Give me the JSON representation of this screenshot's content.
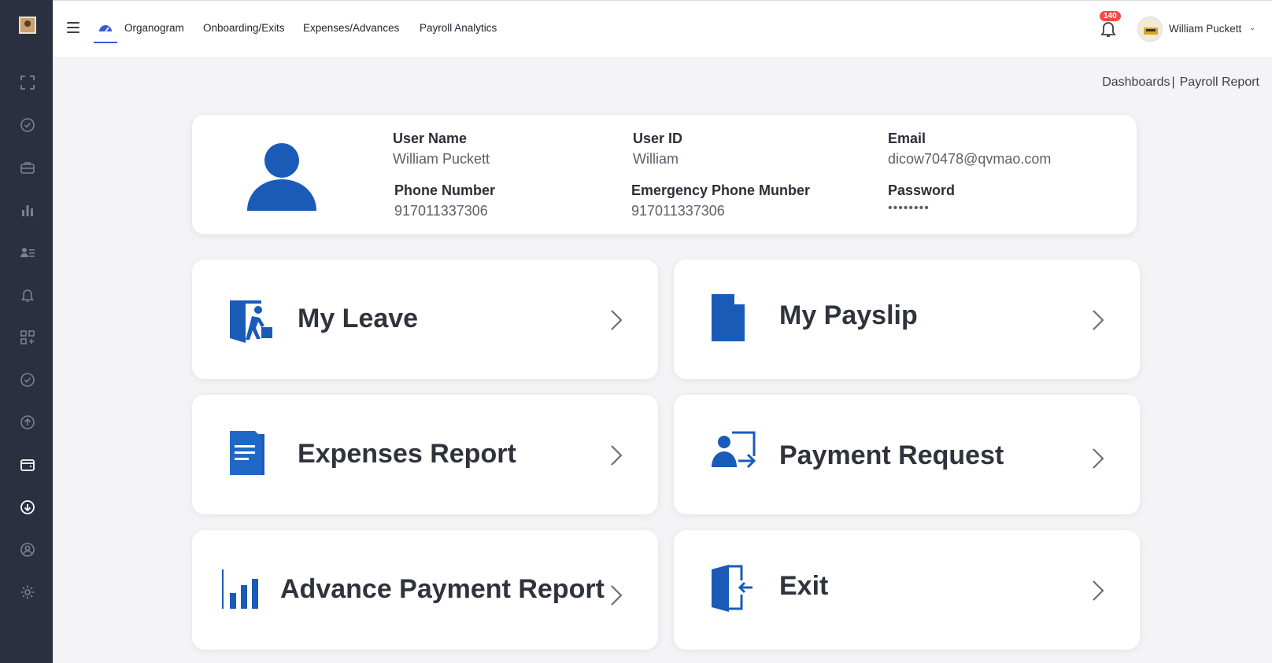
{
  "topbar": {
    "nav": [
      "Organogram",
      "Onboarding/Exits",
      "Expenses/Advances",
      "Payroll Analytics"
    ],
    "notifications_count": "140",
    "user_name": "William Puckett"
  },
  "breadcrumb": {
    "parent": "Dashboards",
    "separator": "|",
    "current": "Payroll Report"
  },
  "profile": {
    "user_name_label": "User Name",
    "user_name": "William Puckett",
    "user_id_label": "User ID",
    "user_id": "William",
    "email_label": "Email",
    "email": "dicow70478@qvmao.com",
    "phone_label": "Phone Number",
    "phone": "917011337306",
    "emergency_label": "Emergency Phone Munber",
    "emergency_phone": "917011337306",
    "password_label": "Password",
    "password": "••••••••"
  },
  "tiles": {
    "my_leave": "My Leave",
    "my_payslip": "My Payslip",
    "expenses_report": "Expenses Report",
    "payment_request": "Payment Request",
    "advance_payment_report": "Advance Payment Report",
    "exit": "Exit"
  },
  "colors": {
    "sidebar_bg": "#2b3040",
    "icon_blue": "#1a5bb8",
    "accent": "#3a5bd9",
    "badge": "#f04b4b"
  },
  "icons": {
    "sidebar": [
      "fullscreen-icon",
      "check-badge-icon",
      "briefcase-icon",
      "bar-chart-icon",
      "user-list-icon",
      "bell-icon",
      "grid-plus-icon",
      "check-badge-icon",
      "upload-circle-icon",
      "wallet-icon",
      "download-circle-icon",
      "user-circle-icon",
      "gear-icon"
    ]
  }
}
